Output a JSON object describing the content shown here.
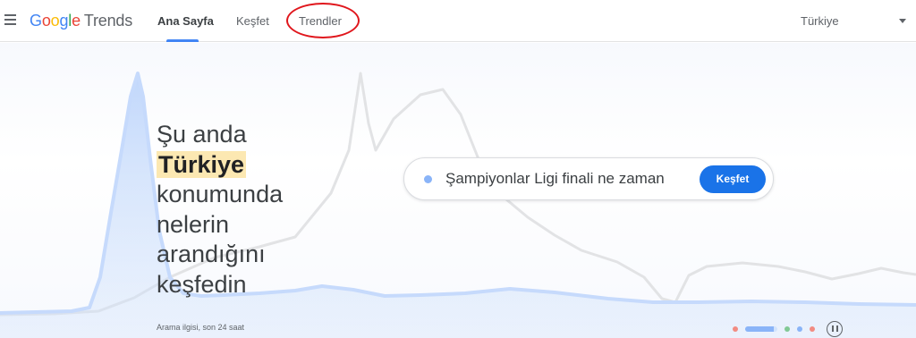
{
  "header": {
    "logo_google": [
      "G",
      "o",
      "o",
      "g",
      "l",
      "e"
    ],
    "logo_product": "Trends",
    "nav": {
      "home": "Ana Sayfa",
      "explore": "Keşfet",
      "trending": "Trendler"
    },
    "region": "Türkiye"
  },
  "hero": {
    "headline_line1": "Şu anda",
    "headline_highlight": "Türkiye",
    "headline_line3": "konumunda",
    "headline_line4": "nelerin",
    "headline_line5": "arandığını",
    "headline_line6": "keşfedin",
    "search_text": "Şampiyonlar Ligi finali ne zaman",
    "explore_button": "Keşfet",
    "caption": "Arama ilgisi, son 24 saat",
    "carousel_progress": 0.9
  },
  "colors": {
    "accent": "#1a73e8",
    "highlight": "#fce8b2",
    "annotation": "#e0161c",
    "carousel_dots": [
      "#f28b82",
      "#8ab4f8",
      "#81c995",
      "#8ab4f8",
      "#f28b82"
    ]
  }
}
